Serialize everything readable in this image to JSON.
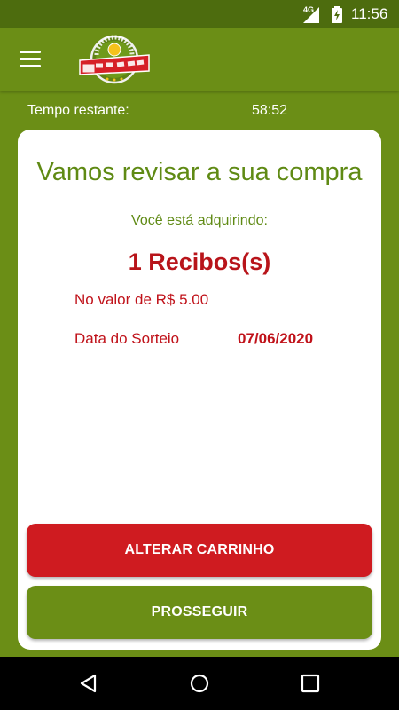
{
  "status_bar": {
    "network": "4G",
    "time": "11:56"
  },
  "app_bar": {
    "logo_text_top": "PAULISTINHA DE",
    "logo_text_main": "PRÊMIOS"
  },
  "timer": {
    "label": "Tempo restante:",
    "value": "58:52"
  },
  "review": {
    "title": "Vamos revisar a sua compra",
    "acquiring_label": "Você está adquirindo:",
    "quantity": "1 Recibos(s)",
    "value_text": "No valor de R$ 5.00",
    "draw_date_label": "Data do Sorteio",
    "draw_date": "07/06/2020"
  },
  "buttons": {
    "change_cart": "ALTERAR CARRINHO",
    "proceed": "PROSSEGUIR"
  },
  "colors": {
    "primary_green": "#6b8e16",
    "dark_green": "#4d6c0e",
    "accent_red": "#cf1b20",
    "text_red": "#c0121a"
  },
  "icons": {
    "menu": "hamburger-menu-icon",
    "back": "triangle-back-icon",
    "home": "circle-home-icon",
    "recent": "square-recent-apps-icon"
  }
}
